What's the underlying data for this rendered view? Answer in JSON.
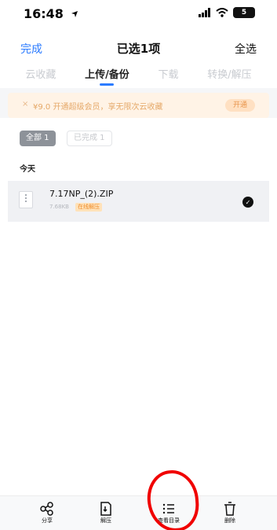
{
  "status_bar": {
    "time": "16:48",
    "battery": "5"
  },
  "nav": {
    "done": "完成",
    "title": "已选1项",
    "select_all": "全选"
  },
  "tabs": [
    {
      "label": "云收藏",
      "active": false
    },
    {
      "label": "上传/备份",
      "active": true
    },
    {
      "label": "下载",
      "active": false
    },
    {
      "label": "转换/解压",
      "active": false
    }
  ],
  "promo": {
    "close": "×",
    "text": "¥9.0 开通超级会员，享无限次云收藏",
    "button": "开通"
  },
  "filters": {
    "all": "全部 1",
    "done": "已完成 1"
  },
  "section": {
    "today": "今天"
  },
  "file": {
    "name": "7.17NP_(2).ZIP",
    "size": "7.68KB",
    "badge": "在线解压",
    "checked": "✓"
  },
  "bottom_actions": [
    {
      "label": "分享",
      "icon": "share-icon"
    },
    {
      "label": "解压",
      "icon": "unzip-icon"
    },
    {
      "label": "查看目录",
      "icon": "list-icon"
    },
    {
      "label": "删除",
      "icon": "trash-icon"
    }
  ],
  "colors": {
    "accent": "#2b7bff",
    "annotation": "#f00000",
    "promo_bg": "#fff3e6",
    "badge_bg": "#ffe2b9",
    "badge_text": "#ee8c2d"
  }
}
